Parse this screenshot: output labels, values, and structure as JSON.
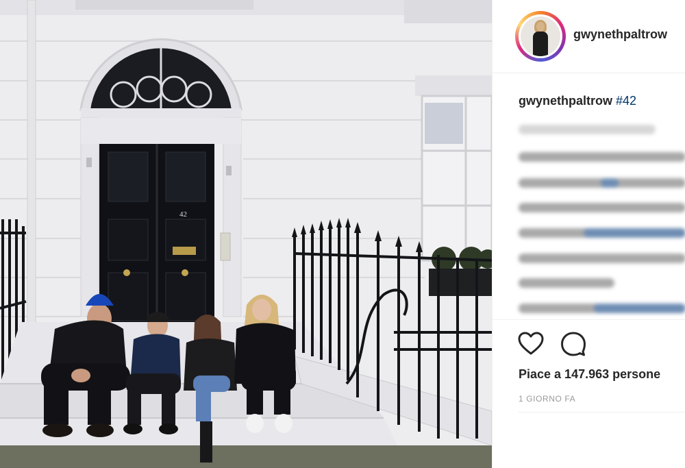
{
  "post": {
    "username": "gwynethpaltrow",
    "caption_user": "gwynethpaltrow",
    "caption_tag": "#42",
    "likes": "Piace a 147.963 persone",
    "time": "1 GIORNO FA",
    "door_number": "42"
  },
  "icons": {
    "like": "heart-outline-icon",
    "comment": "speech-bubble-icon"
  },
  "colors": {
    "text": "#262626",
    "hashtag": "#003569",
    "muted": "#999999",
    "divider": "#efefef"
  }
}
